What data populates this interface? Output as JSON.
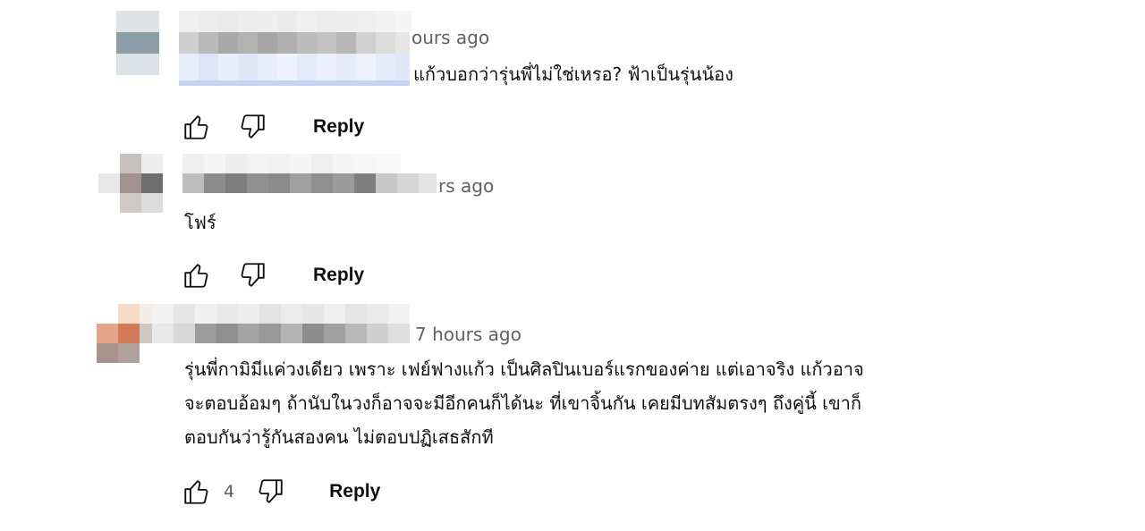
{
  "comments": [
    {
      "time": "ours ago",
      "text": "แก้วบอกว่ารุ่นพี่ไม่ใช่เหรอ? ฟ้าเป็นรุ่นน้อง",
      "likes": "",
      "reply_label": "Reply"
    },
    {
      "time": "rs ago",
      "text": "โฟร์",
      "likes": "",
      "reply_label": "Reply"
    },
    {
      "time": "7 hours ago",
      "text": "รุ่นพี่กามิมีแค่วงเดียว เพราะ เฟย์ฟางแก้ว เป็นศิลปินเบอร์แรกของค่าย แต่เอาจริง แก้วอาจ\nจะตอบอ้อมๆ ถ้านับในวงก็อาจจะมีอีกคนก็ได้นะ ที่เขาจิ้นกัน เคยมีบทสัมตรงๆ ถึงคู่นี้ เขาก็\nตอบกันว่ารู้กันสองคน ไม่ตอบปฏิเสธสักที",
      "likes": "4",
      "reply_label": "Reply"
    }
  ],
  "icons": {
    "like": "thumbs-up-icon",
    "dislike": "thumbs-down-icon"
  }
}
